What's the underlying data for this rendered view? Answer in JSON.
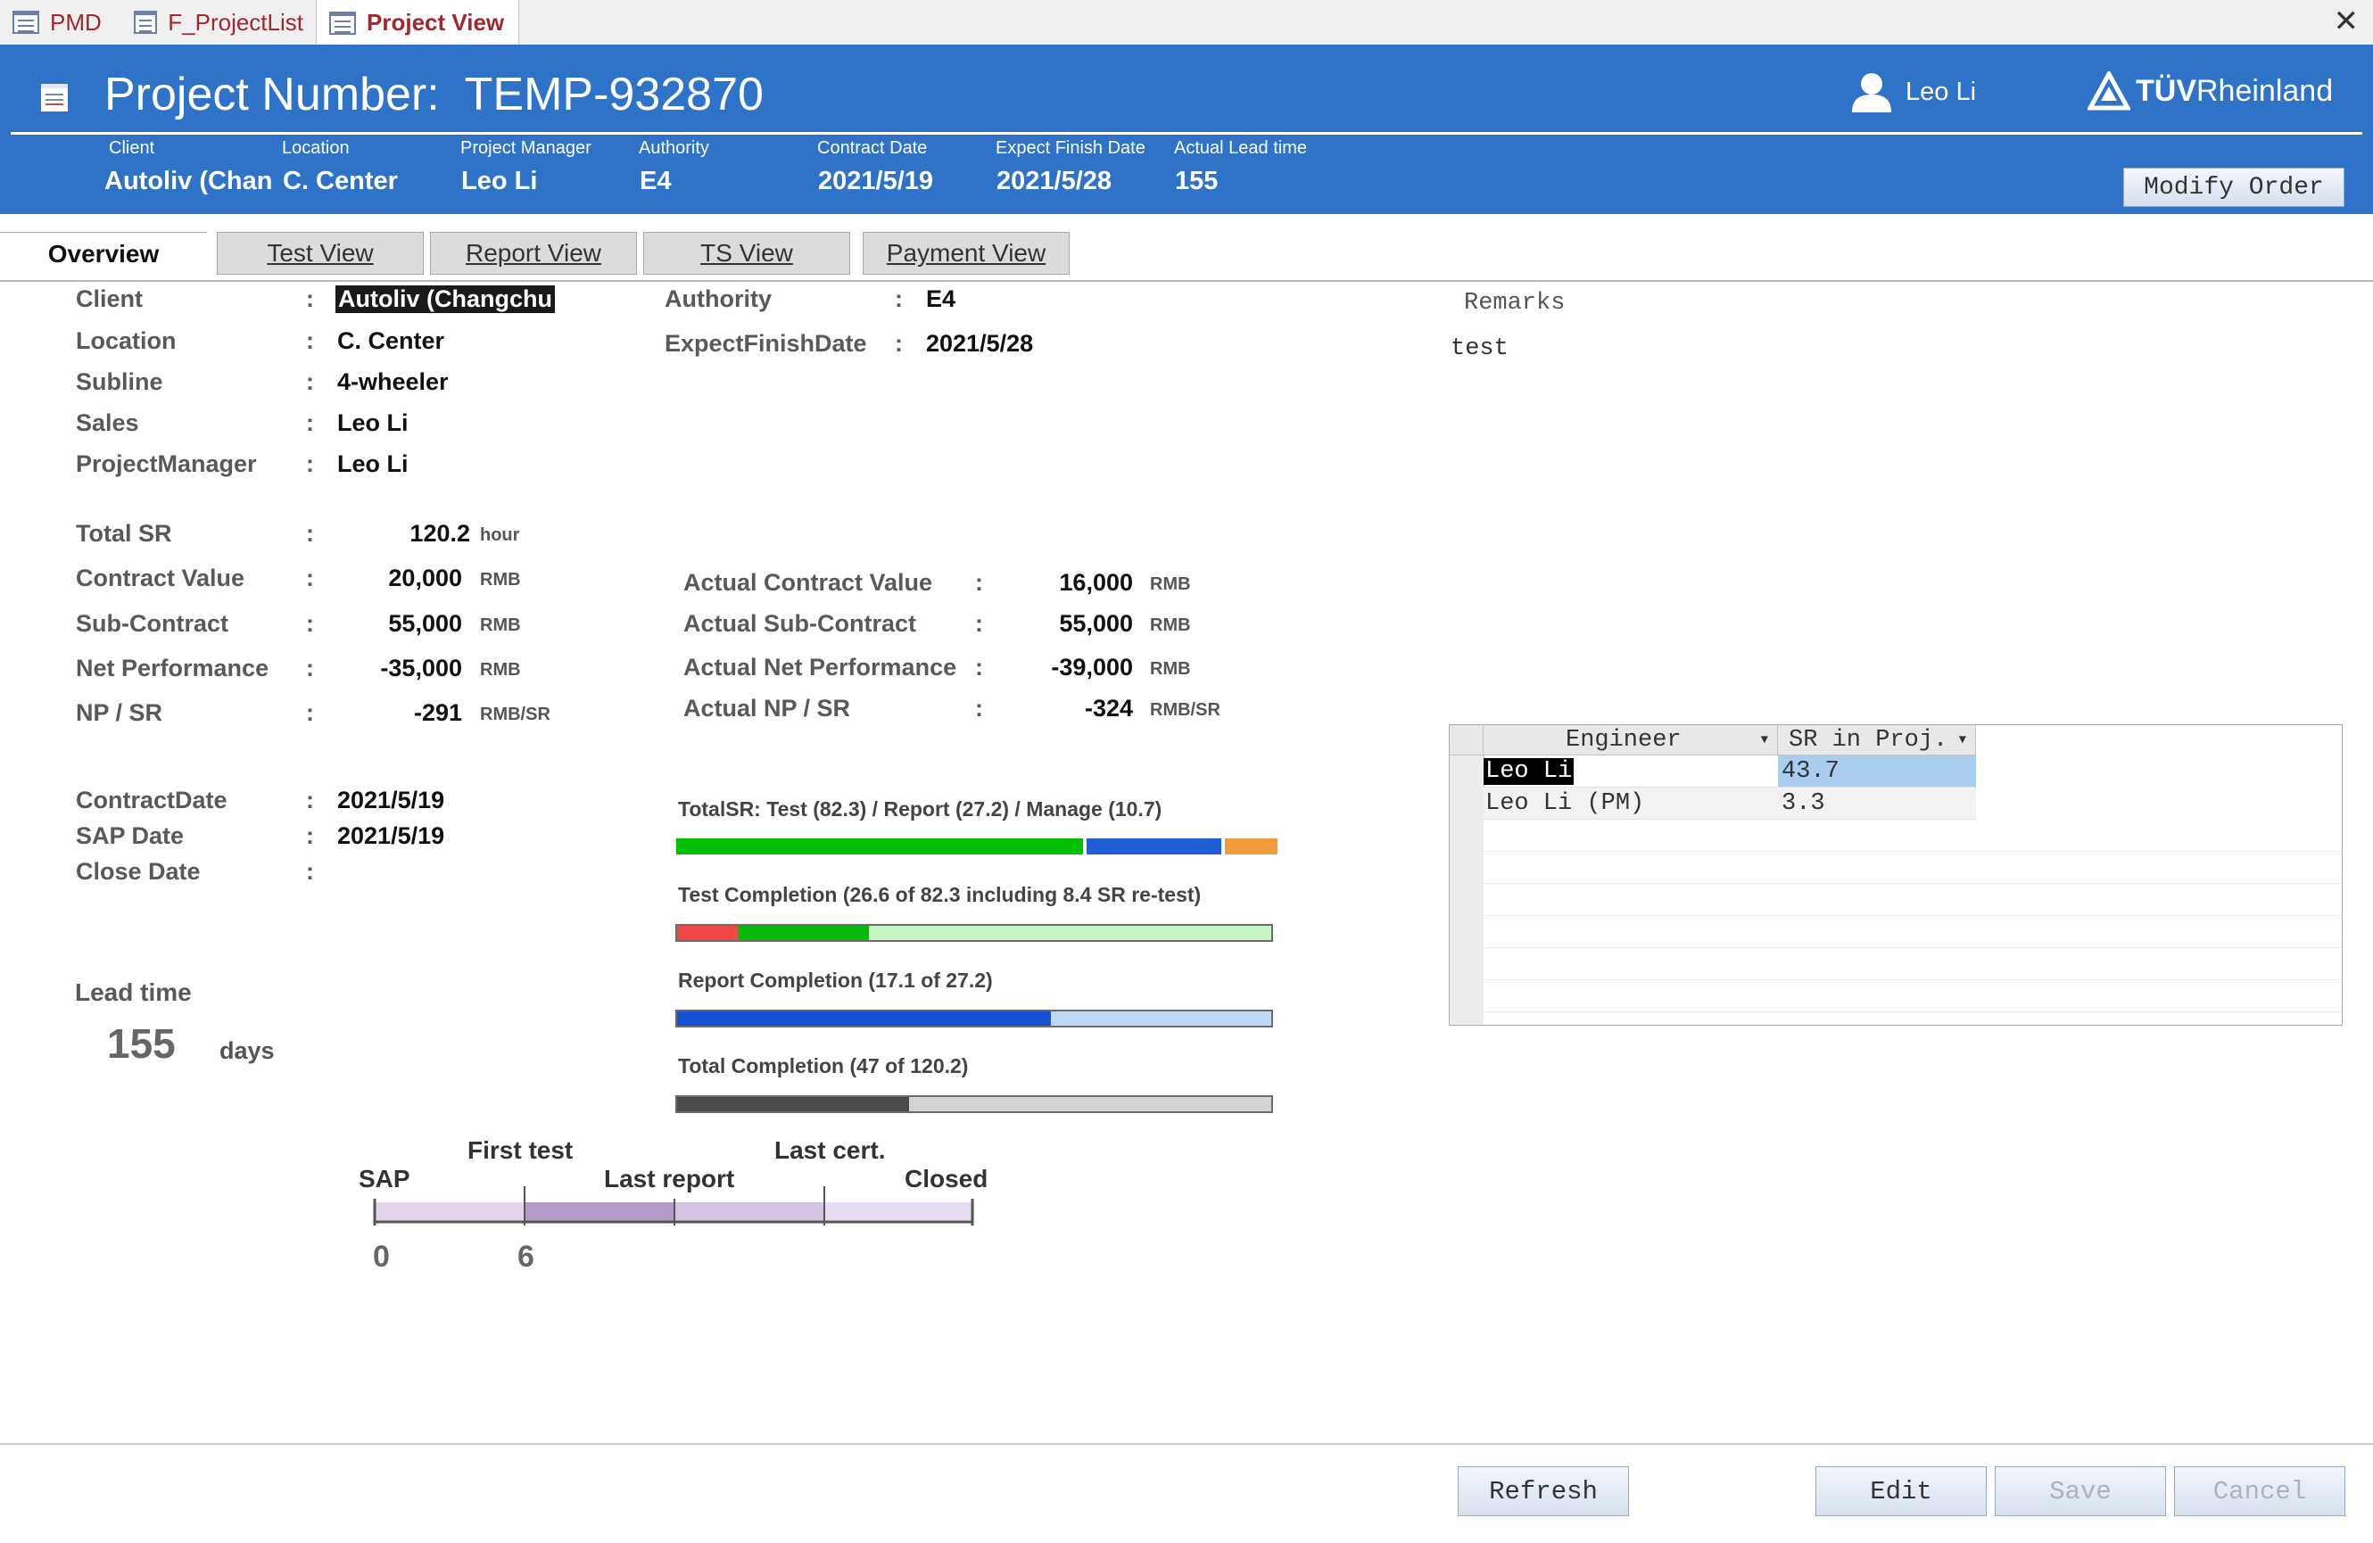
{
  "doc_tabs": [
    {
      "label": "PMD",
      "active": false
    },
    {
      "label": "F_ProjectList",
      "active": false
    },
    {
      "label": "Project View",
      "active": true
    }
  ],
  "header": {
    "title_label": "Project Number:",
    "project_number": "TEMP-932870",
    "user": "Leo Li",
    "brand_a": "TÜV",
    "brand_b": "Rheinland",
    "fields": [
      {
        "label": "Client",
        "value": "Autoliv (Chan"
      },
      {
        "label": "Location",
        "value": "C. Center"
      },
      {
        "label": "Project Manager",
        "value": "Leo Li"
      },
      {
        "label": "Authority",
        "value": "E4"
      },
      {
        "label": "Contract Date",
        "value": "2021/5/19"
      },
      {
        "label": "Expect Finish Date",
        "value": "2021/5/28"
      },
      {
        "label": "Actual Lead time",
        "value": "155"
      }
    ],
    "modify_button": "Modify Order"
  },
  "view_tabs": [
    "Overview",
    "Test View",
    "Report View",
    "TS View",
    "Payment View"
  ],
  "colon": ":",
  "info": {
    "client": {
      "label": "Client",
      "value": "Autoliv (Changchu"
    },
    "location": {
      "label": "Location",
      "value": "C. Center"
    },
    "subline": {
      "label": "Subline",
      "value": "4-wheeler"
    },
    "sales": {
      "label": "Sales",
      "value": "Leo Li"
    },
    "pm": {
      "label": "ProjectManager",
      "value": "Leo Li"
    },
    "authority": {
      "label": "Authority",
      "value": "E4"
    },
    "expect_finish": {
      "label": "ExpectFinishDate",
      "value": "2021/5/28"
    }
  },
  "remarks": {
    "label": "Remarks",
    "value": "test"
  },
  "financials": [
    {
      "label": "Total SR",
      "value": "120.2",
      "unit": "hour"
    },
    {
      "label": "Contract Value",
      "value": "20,000",
      "unit": "RMB"
    },
    {
      "label": "Sub-Contract",
      "value": "55,000",
      "unit": "RMB"
    },
    {
      "label": "Net Performance",
      "value": "-35,000",
      "unit": "RMB"
    },
    {
      "label": "NP / SR",
      "value": "-291",
      "unit": "RMB/SR"
    }
  ],
  "actual_financials": [
    {
      "label": "Actual Contract Value",
      "value": "16,000",
      "unit": "RMB"
    },
    {
      "label": "Actual Sub-Contract",
      "value": "55,000",
      "unit": "RMB"
    },
    {
      "label": "Actual Net Performance",
      "value": "-39,000",
      "unit": "RMB"
    },
    {
      "label": "Actual NP / SR",
      "value": "-324",
      "unit": "RMB/SR"
    }
  ],
  "dates": [
    {
      "label": "ContractDate",
      "value": "2021/5/19"
    },
    {
      "label": "SAP Date",
      "value": "2021/5/19"
    },
    {
      "label": "Close Date",
      "value": ""
    }
  ],
  "lead_time": {
    "label": "Lead time",
    "value": "155",
    "unit": "days"
  },
  "bars": {
    "total_sr": {
      "title": "TotalSR: Test (82.3) / Report (27.2) / Manage (10.7)",
      "segments": [
        {
          "name": "Test",
          "value": 82.3,
          "color": "#00c000"
        },
        {
          "name": "Report",
          "value": 27.2,
          "color": "#1f5fd6"
        },
        {
          "name": "Manage",
          "value": 10.7,
          "color": "#f39a3c"
        }
      ]
    },
    "test_completion": {
      "title": "Test Completion (26.6 of 82.3 including 8.4 SR re-test)",
      "retest": 8.4,
      "done": 26.6,
      "total": 82.3,
      "colors": {
        "retest": "#f04848",
        "done": "#08b808",
        "rest": "#c6f5c6"
      }
    },
    "report_completion": {
      "title": "Report Completion (17.1 of 27.2)",
      "done": 17.1,
      "total": 27.2,
      "colors": {
        "done": "#1452d6",
        "rest": "#bcd8f5"
      }
    },
    "total_completion": {
      "title": "Total Completion (47 of 120.2)",
      "done": 47,
      "total": 120.2,
      "colors": {
        "done": "#4a4a4a",
        "rest": "#d4d4d4"
      }
    }
  },
  "timeline": {
    "labels": {
      "sap": "SAP",
      "first_test": "First test",
      "last_report": "Last report",
      "last_cert": "Last cert.",
      "closed": "Closed"
    },
    "start_value": "0",
    "first_test_value": "6"
  },
  "grid": {
    "columns": [
      "Engineer",
      "SR in Proj."
    ],
    "rows": [
      {
        "engineer": "Leo Li",
        "sr": "43.7"
      },
      {
        "engineer": "Leo Li (PM)",
        "sr": "3.3"
      }
    ]
  },
  "buttons": {
    "refresh": "Refresh",
    "edit": "Edit",
    "save": "Save",
    "cancel": "Cancel"
  }
}
